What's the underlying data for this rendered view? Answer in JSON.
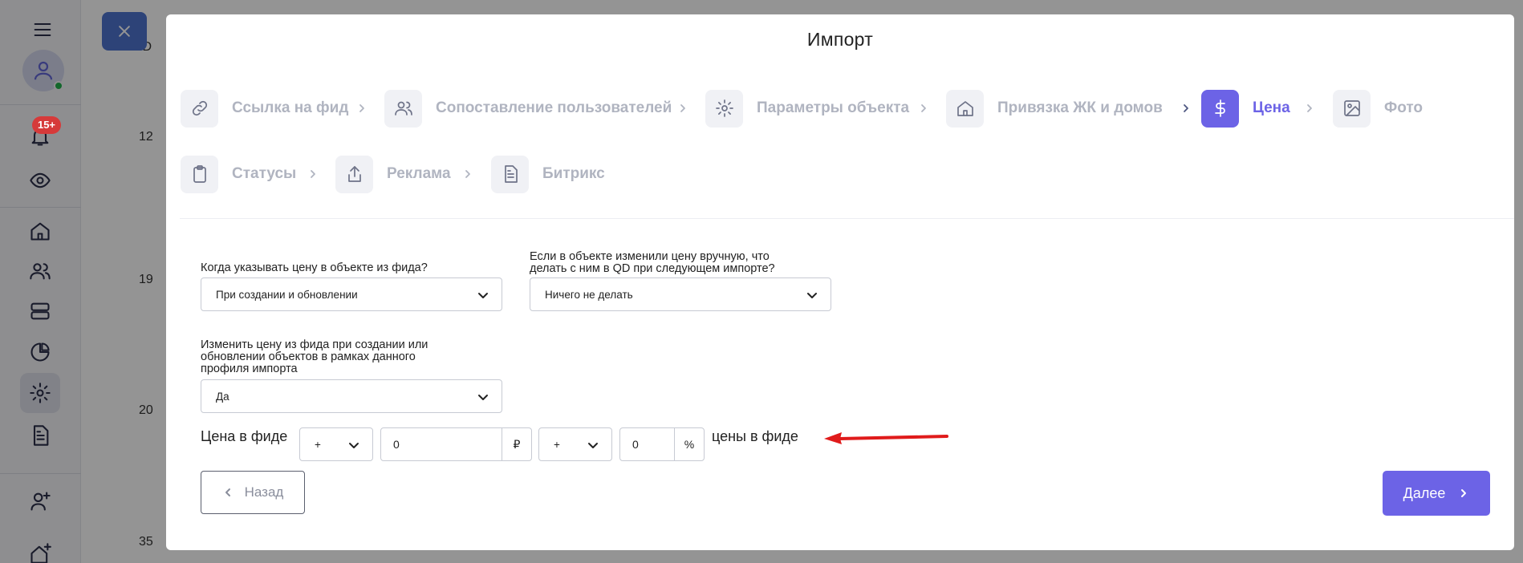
{
  "sidebar": {
    "notification_count": "15+"
  },
  "background": {
    "header_label": "ID",
    "row_numbers": [
      "12",
      "19",
      "20",
      "35"
    ]
  },
  "modal": {
    "title": "Импорт",
    "steps": [
      {
        "label": "Ссылка на фид",
        "icon": "link-icon"
      },
      {
        "label": "Сопоставление пользователей",
        "icon": "users-icon"
      },
      {
        "label": "Параметры объекта",
        "icon": "gear-icon"
      },
      {
        "label": "Привязка ЖК и домов",
        "icon": "home-icon"
      },
      {
        "label": "Цена",
        "icon": "dollar-icon",
        "active": true
      },
      {
        "label": "Фото",
        "icon": "image-icon"
      },
      {
        "label": "Статусы",
        "icon": "clipboard-icon"
      },
      {
        "label": "Реклама",
        "icon": "share-icon"
      },
      {
        "label": "Битрикс",
        "icon": "document-icon"
      }
    ],
    "fields": {
      "when_price_label": "Когда указывать цену в объекте из фида?",
      "when_price_value": "При создании и обновлении",
      "manual_change_label_line1": "Если в объекте изменили цену вручную, что",
      "manual_change_label_line2": "делать с ним в QD при следующем импорте?",
      "manual_change_value": "Ничего не делать",
      "modify_price_label_line1": "Изменить цену из фида при создании или",
      "modify_price_label_line2": "обновлении объектов в рамках данного",
      "modify_price_label_line3": "профиля импорта",
      "modify_price_value": "Да"
    },
    "price_formula": {
      "prefix": "Цена в фиде",
      "sign1": "+",
      "amount": "0",
      "currency": "₽",
      "sign2": "+",
      "percent_value": "0",
      "percent_symbol": "%",
      "suffix": "цены в фиде"
    },
    "buttons": {
      "back": "Назад",
      "next": "Далее"
    }
  },
  "colors": {
    "accent": "#6c63e6",
    "annotation_arrow": "#e01b1b"
  }
}
